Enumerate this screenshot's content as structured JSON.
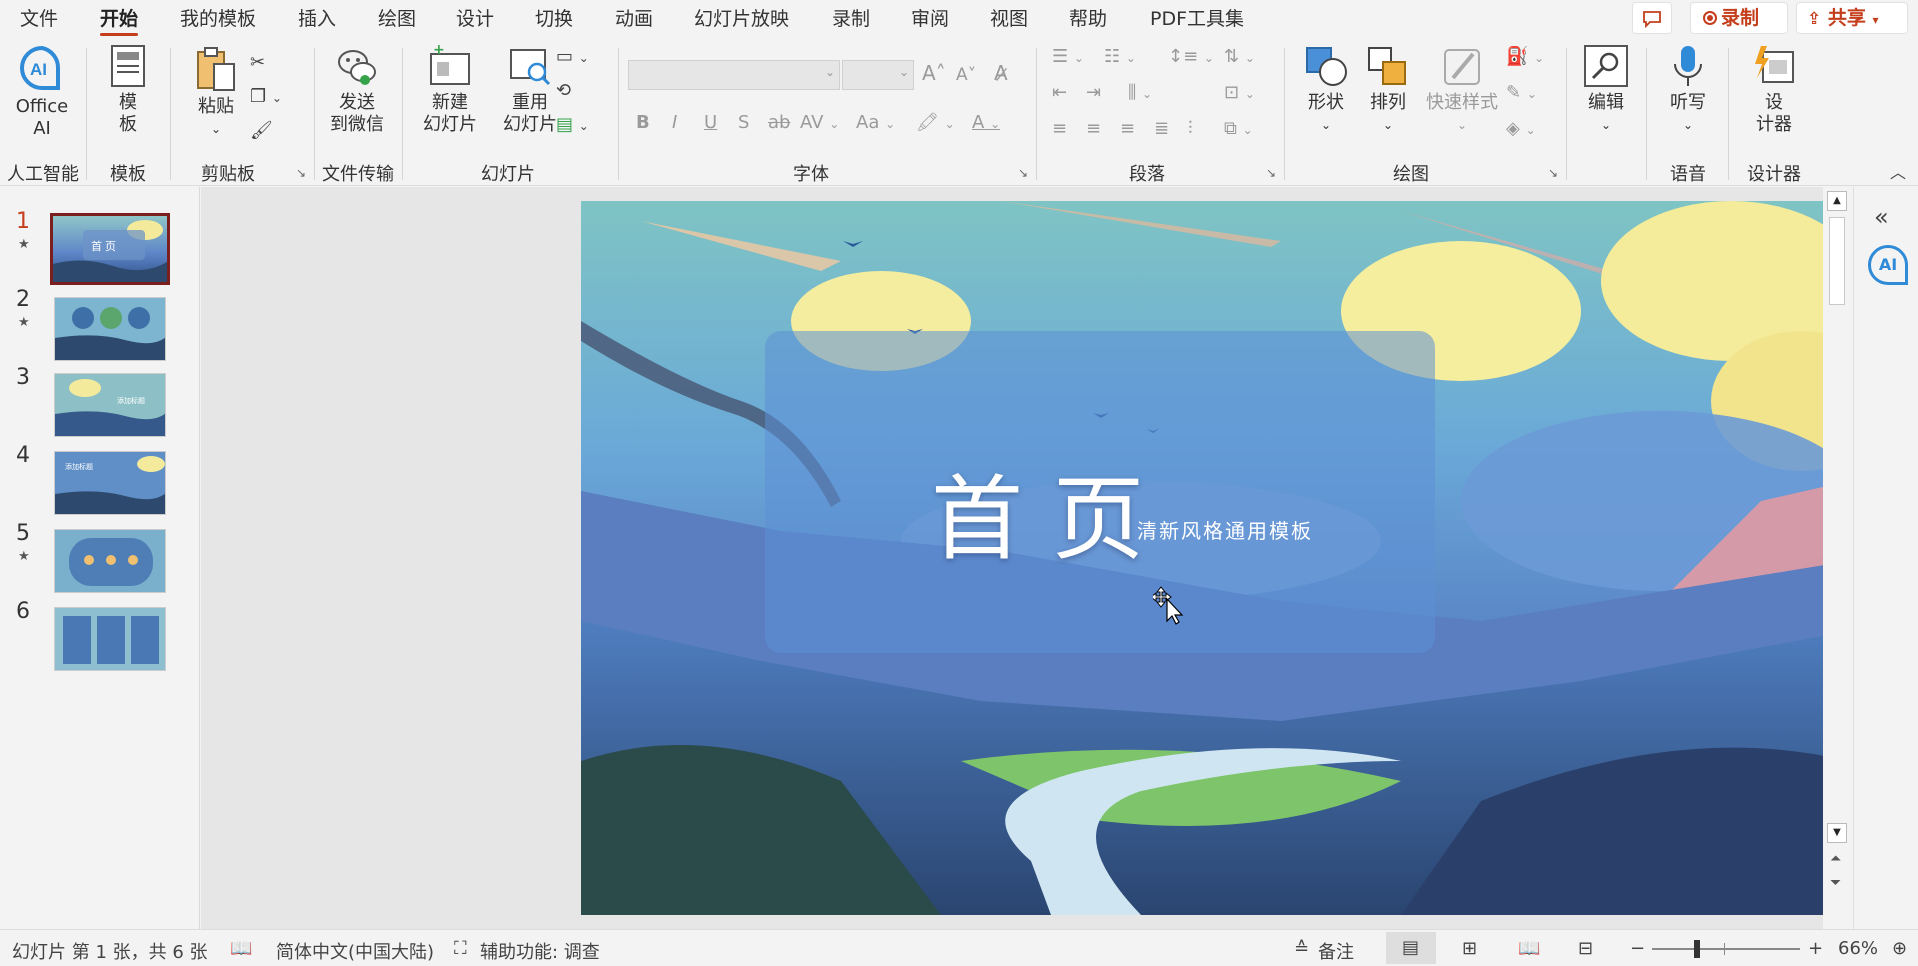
{
  "menu": {
    "tabs": [
      "文件",
      "开始",
      "我的模板",
      "插入",
      "绘图",
      "设计",
      "切换",
      "动画",
      "幻灯片放映",
      "录制",
      "审阅",
      "视图",
      "帮助",
      "PDF工具集"
    ],
    "active": "开始",
    "record_button": "录制",
    "share_button": "共享"
  },
  "ribbon": {
    "ai": {
      "btn_line1": "Office",
      "btn_line2": "AI",
      "label": "人工智能"
    },
    "template": {
      "btn_line1": "模",
      "btn_line2": "板",
      "label": "模板"
    },
    "clipboard": {
      "paste": "粘贴",
      "label": "剪贴板"
    },
    "transfer": {
      "btn_line1": "发送",
      "btn_line2": "到微信",
      "label": "文件传输"
    },
    "slides": {
      "new_line1": "新建",
      "new_line2": "幻灯片",
      "reuse_line1": "重用",
      "reuse_line2": "幻灯片",
      "label": "幻灯片"
    },
    "font": {
      "label": "字体",
      "grow": "A",
      "shrink": "A",
      "bold": "B",
      "italic": "I",
      "underline": "U",
      "shadow": "S",
      "strike": "ab",
      "spacing": "AV",
      "case": "Aa",
      "color": "A"
    },
    "paragraph": {
      "label": "段落"
    },
    "drawing": {
      "shape": "形状",
      "arrange": "排列",
      "quick_style": "快速样式",
      "label": "绘图"
    },
    "edit": {
      "btn": "编辑"
    },
    "voice": {
      "btn": "听写",
      "label": "语音"
    },
    "designer": {
      "btn_line1": "设",
      "btn_line2": "计器",
      "label": "设计器"
    }
  },
  "thumbnails": [
    {
      "num": "1",
      "star": "★",
      "text": "首页"
    },
    {
      "num": "2",
      "star": "★",
      "text": ""
    },
    {
      "num": "3",
      "star": "",
      "text": "添加标题"
    },
    {
      "num": "4",
      "star": "",
      "text": "添加标题"
    },
    {
      "num": "5",
      "star": "★",
      "text": ""
    },
    {
      "num": "6",
      "star": "",
      "text": ""
    }
  ],
  "slide": {
    "title": "首 页",
    "subtitle": "清新风格通用模板"
  },
  "status": {
    "slide_info": "幻灯片 第 1 张，共 6 张",
    "language": "简体中文(中国大陆)",
    "accessibility": "辅助功能: 调查",
    "notes": "备注",
    "zoom_minus": "−",
    "zoom_plus": "+",
    "zoom": "66%"
  },
  "side": {
    "ai": "AI"
  },
  "colors": {
    "accent": "#c43e1c",
    "ai_blue": "#2f8ad8",
    "selection": "#7a1e1e"
  }
}
